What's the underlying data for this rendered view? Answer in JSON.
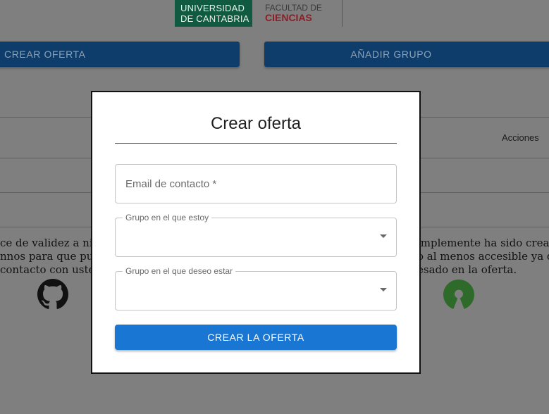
{
  "logos": {
    "university": [
      "UNIVERSIDAD",
      "DE CANTABRIA"
    ],
    "faculty": [
      "FACULTAD DE",
      "CIENCIAS"
    ]
  },
  "toolbar": {
    "create_offer": "CREAR OFERTA",
    "add_group": "AÑADIR GRUPO"
  },
  "table": {
    "actions_header": "Acciones"
  },
  "background_text": {
    "left": [
      "ce de validez a nive",
      "nnos para que pued",
      " contacto con usted"
    ],
    "right": [
      "implemente ha sido cread",
      "o al menos accesible ya qu",
      "esado en la oferta."
    ]
  },
  "modal": {
    "title": "Crear oferta",
    "email_label": "Email de contacto *",
    "group_current_label": "Grupo en el que estoy",
    "group_current_value": "",
    "group_desired_label": "Grupo en el que deseo estar",
    "group_desired_value": "",
    "submit": "CREAR LA OFERTA"
  },
  "icons": {
    "left": "github-icon",
    "right": "open-source-icon"
  },
  "colors": {
    "primary": "#1976d2",
    "backdrop": "#7f7f7f",
    "os_green": "#3da639"
  }
}
